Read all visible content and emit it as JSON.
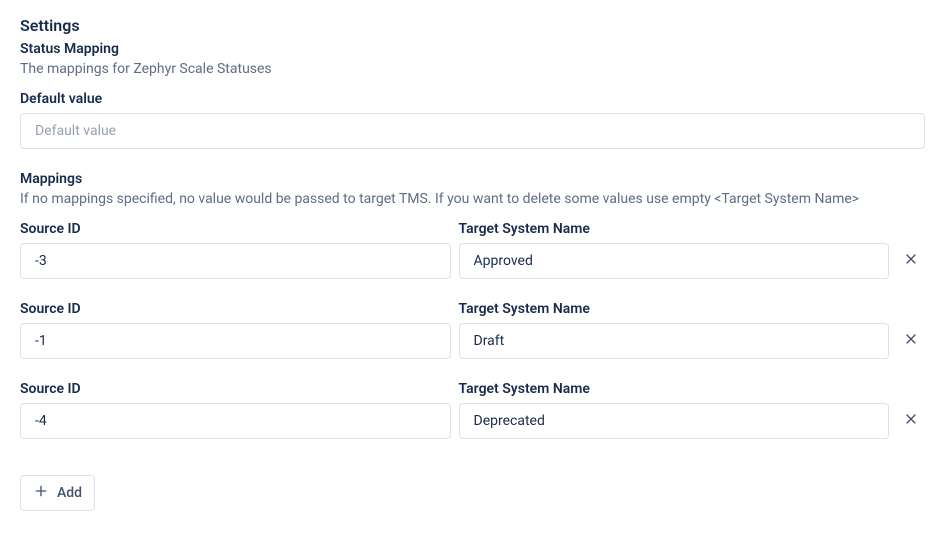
{
  "page_title": "Settings",
  "section_title": "Status Mapping",
  "section_desc": "The mappings for Zephyr Scale Statuses",
  "default_field": {
    "label": "Default value",
    "placeholder": "Default value",
    "value": ""
  },
  "mappings_header": {
    "title": "Mappings",
    "desc": "If no mappings specified, no value would be passed to target TMS. If you want to delete some values use empty <Target System Name>"
  },
  "mapping_labels": {
    "source": "Source ID",
    "target": "Target System Name"
  },
  "mappings": [
    {
      "source": "-3",
      "target": "Approved"
    },
    {
      "source": "-1",
      "target": "Draft"
    },
    {
      "source": "-4",
      "target": "Deprecated"
    }
  ],
  "add_button_label": "Add"
}
